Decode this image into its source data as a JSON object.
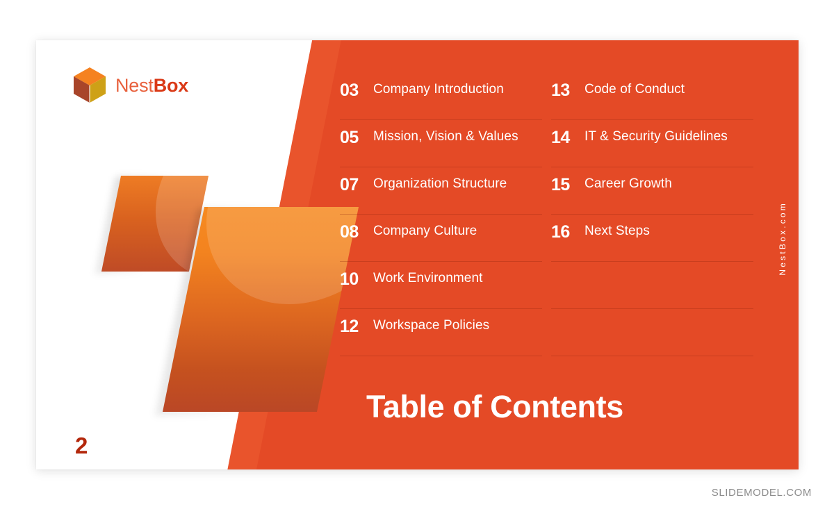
{
  "slide": {
    "title": "Table of Contents",
    "page_number": "2",
    "side_url": "NestBox.com",
    "accent_color": "#E44A26",
    "shape_top_color": "#F68A20",
    "shape_bottom_color": "#BA4726",
    "page_number_color": "#B3270B"
  },
  "logo": {
    "icon": "cube-logo-icon",
    "name_light": "Nest",
    "name_bold": "Box",
    "light_color": "#E8603C",
    "bold_color": "#DA3A17",
    "cube_top_color": "#F58220",
    "cube_left_color": "#A8452A",
    "cube_right_color": "#CEA117"
  },
  "toc": {
    "left_column": [
      {
        "number": "03",
        "label": "Company Introduction"
      },
      {
        "number": "05",
        "label": "Mission, Vision & Values"
      },
      {
        "number": "07",
        "label": "Organization Structure"
      },
      {
        "number": "08",
        "label": "Company Culture"
      },
      {
        "number": "10",
        "label": "Work Environment"
      },
      {
        "number": "12",
        "label": "Workspace Policies"
      }
    ],
    "right_column": [
      {
        "number": "13",
        "label": "Code of Conduct"
      },
      {
        "number": "14",
        "label": "IT & Security Guidelines"
      },
      {
        "number": "15",
        "label": "Career Growth"
      },
      {
        "number": "16",
        "label": "Next Steps"
      },
      {
        "number": "",
        "label": ""
      },
      {
        "number": "",
        "label": ""
      }
    ]
  },
  "footer": {
    "watermark": "SLIDEMODEL.COM"
  }
}
